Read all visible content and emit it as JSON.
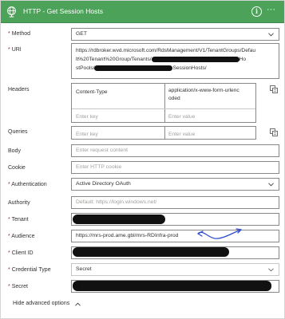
{
  "header": {
    "title": "HTTP - Get Session Hosts",
    "info_label": "i",
    "more_label": "···"
  },
  "method": {
    "label": "Method",
    "value": "GET"
  },
  "uri": {
    "label": "URI",
    "line1": "https://rdbroker.wvd.microsoft.com/RdsManagement/V1/TenantGroups/Defau",
    "line2_a": "lt%20Tenant%20Group/Tenants/",
    "line2_b": "Ho",
    "line3_a": "stPools/",
    "line3_b": "SessionHosts/"
  },
  "headers": {
    "label": "Headers",
    "key": "Content-Type",
    "value_line1": "application/x-www-form-urlenc",
    "value_line2": "oded",
    "key_placeholder": "Enter key",
    "value_placeholder": "Enter value"
  },
  "queries": {
    "label": "Queries",
    "key_placeholder": "Enter key",
    "value_placeholder": "Enter value"
  },
  "body": {
    "label": "Body",
    "placeholder": "Enter request content"
  },
  "cookie": {
    "label": "Cookie",
    "placeholder": "Enter HTTP cookie"
  },
  "authentication": {
    "label": "Authentication",
    "value": "Active Directory OAuth"
  },
  "authority": {
    "label": "Authority",
    "placeholder": "Default: https://login.windows.net/"
  },
  "tenant": {
    "label": "Tenant"
  },
  "audience": {
    "label": "Audience",
    "value": "https://mrs-prod.ame.gbl/mrs-RDInfra-prod"
  },
  "client_id": {
    "label": "Client ID"
  },
  "credential_type": {
    "label": "Credential Type",
    "value": "Secret"
  },
  "secret": {
    "label": "Secret"
  },
  "footer": {
    "hide_advanced": "Hide advanced options"
  },
  "colors": {
    "header": "#4ba258",
    "required": "#a4262c",
    "annotation": "#2f4bd1"
  }
}
